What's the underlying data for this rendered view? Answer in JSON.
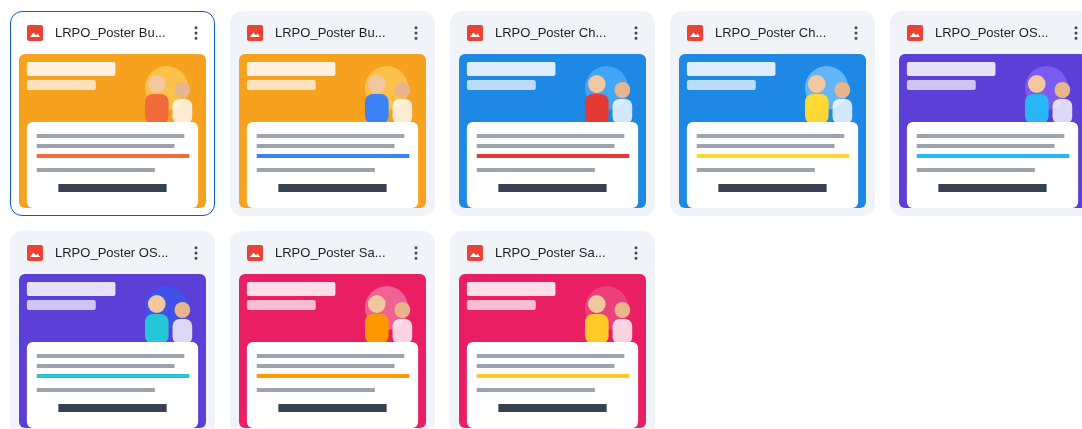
{
  "files": [
    {
      "name": "LRPO_Poster Bu...",
      "selected": true
    },
    {
      "name": "LRPO_Poster Bu...",
      "selected": false
    },
    {
      "name": "LRPO_Poster Ch...",
      "selected": false
    },
    {
      "name": "LRPO_Poster Ch...",
      "selected": false
    },
    {
      "name": "LRPO_Poster OS...",
      "selected": false
    },
    {
      "name": "LRPO_Poster OS...",
      "selected": false
    },
    {
      "name": "LRPO_Poster Sa...",
      "selected": false
    },
    {
      "name": "LRPO_Poster Sa...",
      "selected": false
    }
  ]
}
